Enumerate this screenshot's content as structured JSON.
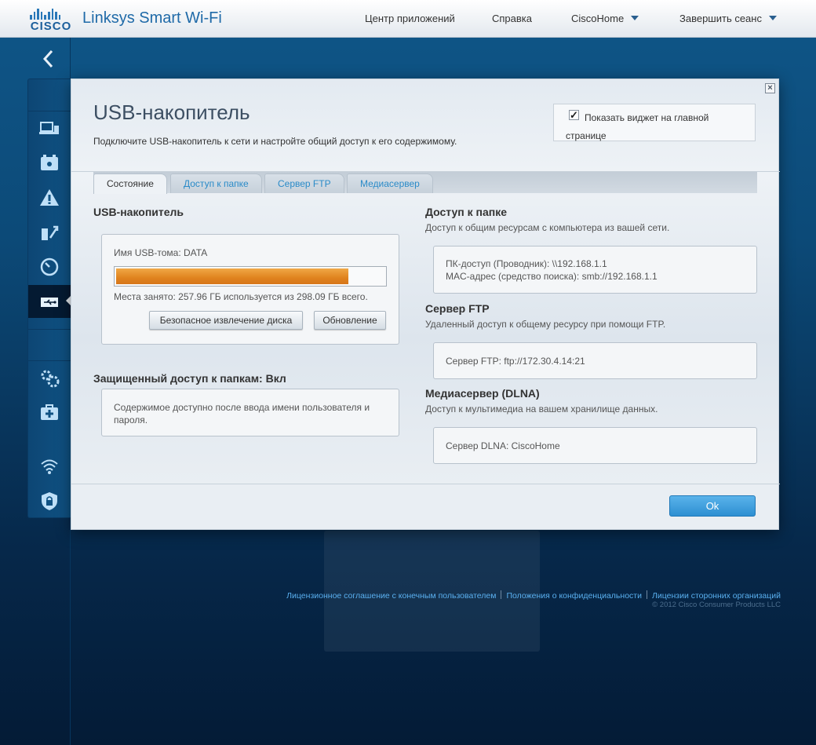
{
  "header": {
    "logo_text": "CISCO",
    "app_title": "Linksys Smart Wi-Fi",
    "nav": {
      "app_center": "Центр приложений",
      "help": "Справка",
      "router_name": "CiscoHome",
      "logout": "Завершить сеанс"
    }
  },
  "sidebar": {
    "items": [
      {
        "icon": "devices-icon"
      },
      {
        "icon": "parental-controls-icon"
      },
      {
        "icon": "alert-icon"
      },
      {
        "icon": "media-prioritization-icon"
      },
      {
        "icon": "speed-test-icon"
      },
      {
        "icon": "usb-storage-icon",
        "active": true
      },
      {
        "icon": "settings-icon"
      },
      {
        "icon": "troubleshooting-icon"
      },
      {
        "icon": "wireless-icon"
      },
      {
        "icon": "security-icon"
      }
    ]
  },
  "modal": {
    "title": "USB-накопитель",
    "description": "Подключите USB-накопитель к сети и настройте общий доступ к его содержимому.",
    "widget_checkbox_label": "Показать виджет на главной странице",
    "widget_checked": true,
    "tabs": [
      "Состояние",
      "Доступ к папке",
      "Сервер FTP",
      "Медиасервер"
    ],
    "active_tab": 0,
    "usb": {
      "heading": "USB-накопитель",
      "volume_name": "Имя USB-тома: DATA",
      "usage_fraction": 0.865,
      "usage_text": "Места занято: 257.96 ГБ используется из 298.09 ГБ всего.",
      "eject_button": "Безопасное извлечение диска",
      "refresh_button": "Обновление"
    },
    "secure_access": {
      "heading": "Защищенный доступ к папкам: Вкл",
      "text": "Содержимое доступно после ввода имени пользователя и пароля."
    },
    "folder_access": {
      "heading": "Доступ к папке",
      "desc": "Доступ к общим ресурсам с компьютера из вашей сети.",
      "line1": "ПК-доступ (Проводник): \\\\192.168.1.1",
      "line2": "MAC-адрес (средство поиска): smb://192.168.1.1"
    },
    "ftp": {
      "heading": "Сервер FTP",
      "desc": "Удаленный доступ к общему ресурсу при помощи FTP.",
      "line1": "Сервер FTP: ftp://172.30.4.14:21"
    },
    "media": {
      "heading": "Медиасервер (DLNA)",
      "desc": "Доступ к мультимедиа на вашем хранилище данных.",
      "line1": "Сервер DLNA: CiscoHome"
    },
    "ok_button": "Ok",
    "close_glyph": "×"
  },
  "footer": {
    "links": [
      "Лицензионное соглашение с конечным пользователем",
      "Положения о конфиденциальности",
      "Лицензии сторонних организаций"
    ],
    "copyright": "© 2012 Cisco Consumer Products LLC"
  },
  "colors": {
    "accent": "#2a8bc8",
    "progress": "#e0831e",
    "ok_button": "#3a9ada"
  }
}
